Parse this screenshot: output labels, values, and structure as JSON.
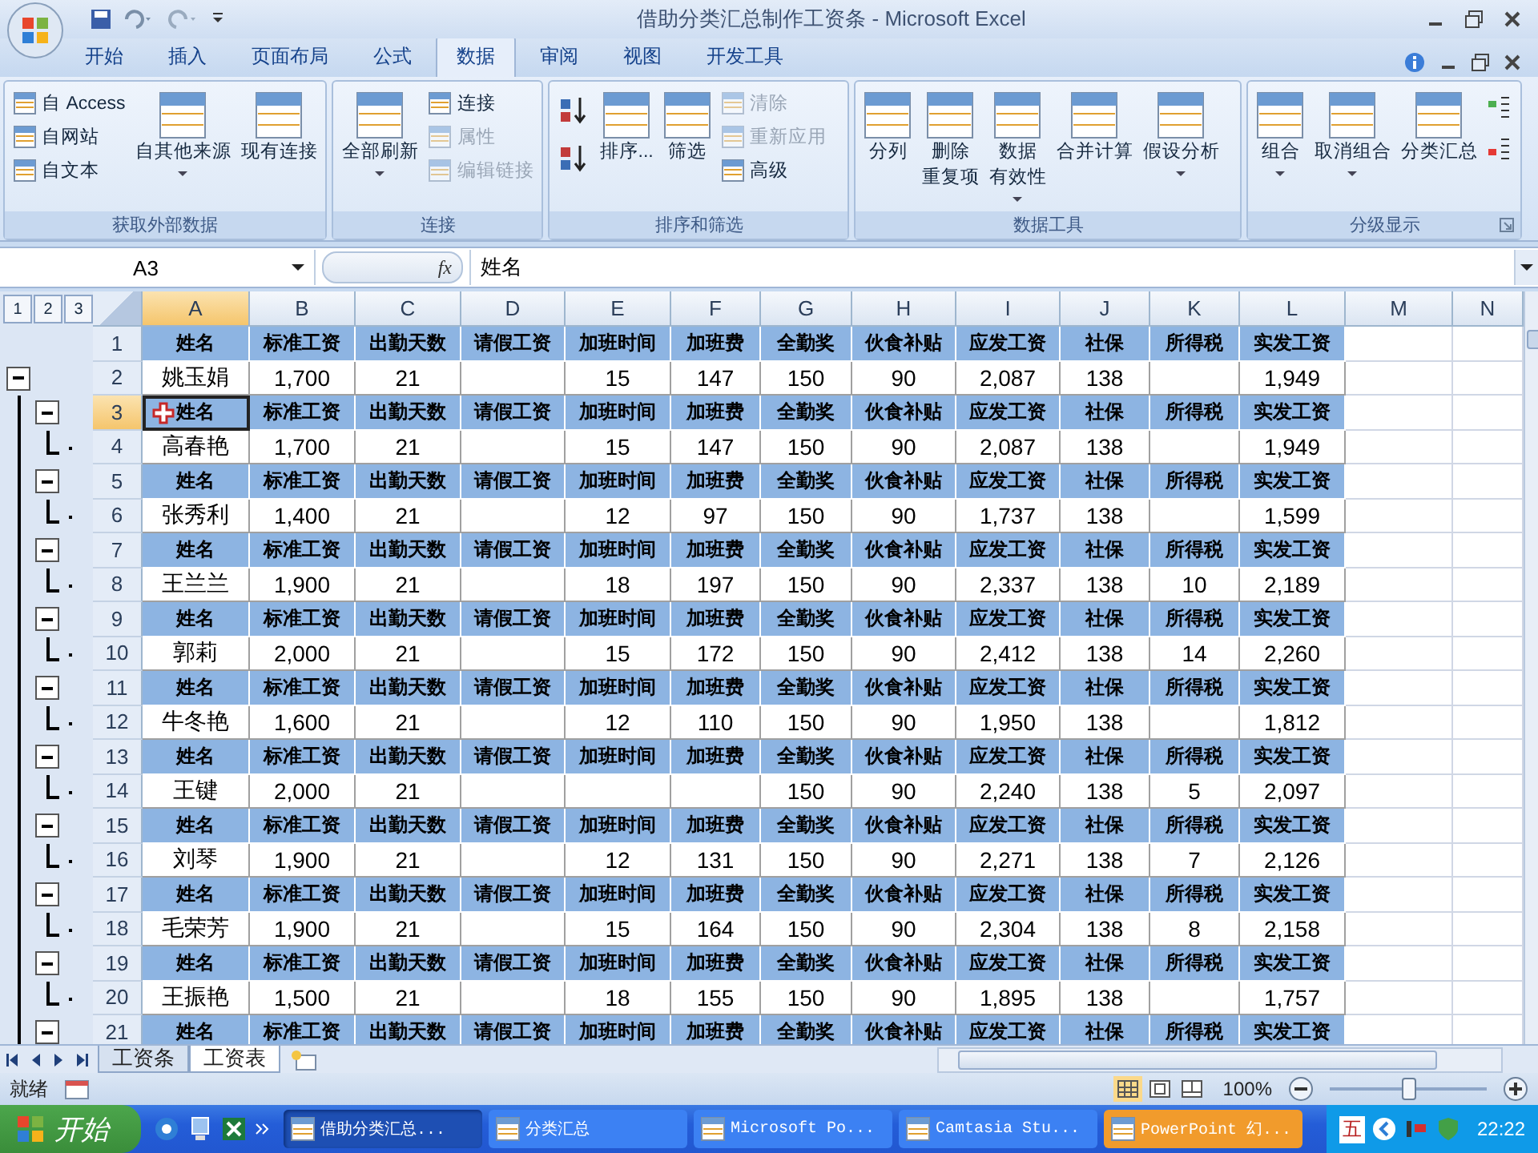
{
  "window": {
    "title": "借助分类汇总制作工资条 - Microsoft Excel"
  },
  "ribbon": {
    "tabs": [
      {
        "label": "开始",
        "selected": false
      },
      {
        "label": "插入",
        "selected": false
      },
      {
        "label": "页面布局",
        "selected": false
      },
      {
        "label": "公式",
        "selected": false
      },
      {
        "label": "数据",
        "selected": true
      },
      {
        "label": "审阅",
        "selected": false
      },
      {
        "label": "视图",
        "selected": false
      },
      {
        "label": "开发工具",
        "selected": false
      }
    ],
    "groups": [
      {
        "title": "获取外部数据",
        "launcher": false,
        "columns": [
          {
            "kind": "stack",
            "items": [
              {
                "label": "自 Access",
                "disabled": false
              },
              {
                "label": "自网站",
                "disabled": false
              },
              {
                "label": "自文本",
                "disabled": false
              }
            ]
          },
          {
            "kind": "large",
            "label_lines": [
              "自其他来源"
            ],
            "dropdown": true
          },
          {
            "kind": "large",
            "label_lines": [
              "现有连接"
            ],
            "dropdown": false
          }
        ]
      },
      {
        "title": "连接",
        "launcher": false,
        "columns": [
          {
            "kind": "large",
            "label_lines": [
              "全部刷新"
            ],
            "dropdown": true
          },
          {
            "kind": "stack",
            "items": [
              {
                "label": "连接",
                "disabled": false
              },
              {
                "label": "属性",
                "disabled": true
              },
              {
                "label": "编辑链接",
                "disabled": true
              }
            ]
          }
        ]
      },
      {
        "title": "排序和筛选",
        "launcher": false,
        "columns": [
          {
            "kind": "sort-buttons"
          },
          {
            "kind": "large",
            "label_lines": [
              "排序..."
            ],
            "dropdown": false
          },
          {
            "kind": "large",
            "label_lines": [
              "筛选"
            ],
            "dropdown": false
          },
          {
            "kind": "stack",
            "items": [
              {
                "label": "清除",
                "disabled": true
              },
              {
                "label": "重新应用",
                "disabled": true
              },
              {
                "label": "高级",
                "disabled": false
              }
            ]
          }
        ]
      },
      {
        "title": "数据工具",
        "launcher": false,
        "columns": [
          {
            "kind": "large",
            "label_lines": [
              "分列"
            ],
            "dropdown": false
          },
          {
            "kind": "large",
            "label_lines": [
              "删除",
              "重复项"
            ],
            "dropdown": false
          },
          {
            "kind": "large",
            "label_lines": [
              "数据",
              "有效性"
            ],
            "dropdown": true
          },
          {
            "kind": "large",
            "label_lines": [
              "合并计算"
            ],
            "dropdown": false
          },
          {
            "kind": "large",
            "label_lines": [
              "假设分析"
            ],
            "dropdown": true
          }
        ]
      },
      {
        "title": "分级显示",
        "launcher": true,
        "columns": [
          {
            "kind": "large",
            "label_lines": [
              "组合"
            ],
            "dropdown": true
          },
          {
            "kind": "large",
            "label_lines": [
              "取消组合"
            ],
            "dropdown": true
          },
          {
            "kind": "large",
            "label_lines": [
              "分类汇总"
            ],
            "dropdown": false
          },
          {
            "kind": "outline-buttons"
          }
        ]
      }
    ]
  },
  "formula_bar": {
    "name_box": "A3",
    "function_label": "fx",
    "formula": "姓名"
  },
  "sheet": {
    "outline_levels": [
      "1",
      "2",
      "3"
    ],
    "columns": [
      {
        "label": "A",
        "selected": true
      },
      {
        "label": "B",
        "selected": false
      },
      {
        "label": "C",
        "selected": false
      },
      {
        "label": "D",
        "selected": false
      },
      {
        "label": "E",
        "selected": false
      },
      {
        "label": "F",
        "selected": false
      },
      {
        "label": "G",
        "selected": false
      },
      {
        "label": "H",
        "selected": false
      },
      {
        "label": "I",
        "selected": false
      },
      {
        "label": "J",
        "selected": false
      },
      {
        "label": "K",
        "selected": false
      },
      {
        "label": "L",
        "selected": false
      },
      {
        "label": "M",
        "selected": false
      },
      {
        "label": "N",
        "selected": false
      }
    ],
    "rows": [
      {
        "number": "1",
        "kind": "header",
        "group_button": false,
        "subgroup_button": false,
        "detail_mark": false,
        "selected": false,
        "cells": [
          "姓名",
          "标准工资",
          "出勤天数",
          "请假工资",
          "加班时间",
          "加班费",
          "全勤奖",
          "伙食补贴",
          "应发工资",
          "社保",
          "所得税",
          "实发工资"
        ]
      },
      {
        "number": "2",
        "kind": "data",
        "group_button": true,
        "subgroup_button": false,
        "detail_mark": false,
        "selected": false,
        "cells": [
          "姚玉娟",
          "1,700",
          "21",
          null,
          "15",
          "147",
          "150",
          "90",
          "2,087",
          "138",
          null,
          "1,949"
        ]
      },
      {
        "number": "3",
        "kind": "header",
        "group_button": false,
        "subgroup_button": true,
        "detail_mark": false,
        "selected": true,
        "cells": [
          "姓名",
          "标准工资",
          "出勤天数",
          "请假工资",
          "加班时间",
          "加班费",
          "全勤奖",
          "伙食补贴",
          "应发工资",
          "社保",
          "所得税",
          "实发工资"
        ]
      },
      {
        "number": "4",
        "kind": "data",
        "group_button": false,
        "subgroup_button": false,
        "detail_mark": true,
        "selected": false,
        "cells": [
          "高春艳",
          "1,700",
          "21",
          null,
          "15",
          "147",
          "150",
          "90",
          "2,087",
          "138",
          null,
          "1,949"
        ]
      },
      {
        "number": "5",
        "kind": "header",
        "group_button": false,
        "subgroup_button": true,
        "detail_mark": false,
        "selected": false,
        "cells": [
          "姓名",
          "标准工资",
          "出勤天数",
          "请假工资",
          "加班时间",
          "加班费",
          "全勤奖",
          "伙食补贴",
          "应发工资",
          "社保",
          "所得税",
          "实发工资"
        ]
      },
      {
        "number": "6",
        "kind": "data",
        "group_button": false,
        "subgroup_button": false,
        "detail_mark": true,
        "selected": false,
        "cells": [
          "张秀利",
          "1,400",
          "21",
          null,
          "12",
          "97",
          "150",
          "90",
          "1,737",
          "138",
          null,
          "1,599"
        ]
      },
      {
        "number": "7",
        "kind": "header",
        "group_button": false,
        "subgroup_button": true,
        "detail_mark": false,
        "selected": false,
        "cells": [
          "姓名",
          "标准工资",
          "出勤天数",
          "请假工资",
          "加班时间",
          "加班费",
          "全勤奖",
          "伙食补贴",
          "应发工资",
          "社保",
          "所得税",
          "实发工资"
        ]
      },
      {
        "number": "8",
        "kind": "data",
        "group_button": false,
        "subgroup_button": false,
        "detail_mark": true,
        "selected": false,
        "cells": [
          "王兰兰",
          "1,900",
          "21",
          null,
          "18",
          "197",
          "150",
          "90",
          "2,337",
          "138",
          "10",
          "2,189"
        ]
      },
      {
        "number": "9",
        "kind": "header",
        "group_button": false,
        "subgroup_button": true,
        "detail_mark": false,
        "selected": false,
        "cells": [
          "姓名",
          "标准工资",
          "出勤天数",
          "请假工资",
          "加班时间",
          "加班费",
          "全勤奖",
          "伙食补贴",
          "应发工资",
          "社保",
          "所得税",
          "实发工资"
        ]
      },
      {
        "number": "10",
        "kind": "data",
        "group_button": false,
        "subgroup_button": false,
        "detail_mark": true,
        "selected": false,
        "cells": [
          "郭莉",
          "2,000",
          "21",
          null,
          "15",
          "172",
          "150",
          "90",
          "2,412",
          "138",
          "14",
          "2,260"
        ]
      },
      {
        "number": "11",
        "kind": "header",
        "group_button": false,
        "subgroup_button": true,
        "detail_mark": false,
        "selected": false,
        "cells": [
          "姓名",
          "标准工资",
          "出勤天数",
          "请假工资",
          "加班时间",
          "加班费",
          "全勤奖",
          "伙食补贴",
          "应发工资",
          "社保",
          "所得税",
          "实发工资"
        ]
      },
      {
        "number": "12",
        "kind": "data",
        "group_button": false,
        "subgroup_button": false,
        "detail_mark": true,
        "selected": false,
        "cells": [
          "牛冬艳",
          "1,600",
          "21",
          null,
          "12",
          "110",
          "150",
          "90",
          "1,950",
          "138",
          null,
          "1,812"
        ]
      },
      {
        "number": "13",
        "kind": "header",
        "group_button": false,
        "subgroup_button": true,
        "detail_mark": false,
        "selected": false,
        "cells": [
          "姓名",
          "标准工资",
          "出勤天数",
          "请假工资",
          "加班时间",
          "加班费",
          "全勤奖",
          "伙食补贴",
          "应发工资",
          "社保",
          "所得税",
          "实发工资"
        ]
      },
      {
        "number": "14",
        "kind": "data",
        "group_button": false,
        "subgroup_button": false,
        "detail_mark": true,
        "selected": false,
        "cells": [
          "王键",
          "2,000",
          "21",
          null,
          null,
          null,
          "150",
          "90",
          "2,240",
          "138",
          "5",
          "2,097"
        ]
      },
      {
        "number": "15",
        "kind": "header",
        "group_button": false,
        "subgroup_button": true,
        "detail_mark": false,
        "selected": false,
        "cells": [
          "姓名",
          "标准工资",
          "出勤天数",
          "请假工资",
          "加班时间",
          "加班费",
          "全勤奖",
          "伙食补贴",
          "应发工资",
          "社保",
          "所得税",
          "实发工资"
        ]
      },
      {
        "number": "16",
        "kind": "data",
        "group_button": false,
        "subgroup_button": false,
        "detail_mark": true,
        "selected": false,
        "cells": [
          "刘琴",
          "1,900",
          "21",
          null,
          "12",
          "131",
          "150",
          "90",
          "2,271",
          "138",
          "7",
          "2,126"
        ]
      },
      {
        "number": "17",
        "kind": "header",
        "group_button": false,
        "subgroup_button": true,
        "detail_mark": false,
        "selected": false,
        "cells": [
          "姓名",
          "标准工资",
          "出勤天数",
          "请假工资",
          "加班时间",
          "加班费",
          "全勤奖",
          "伙食补贴",
          "应发工资",
          "社保",
          "所得税",
          "实发工资"
        ]
      },
      {
        "number": "18",
        "kind": "data",
        "group_button": false,
        "subgroup_button": false,
        "detail_mark": true,
        "selected": false,
        "cells": [
          "毛荣芳",
          "1,900",
          "21",
          null,
          "15",
          "164",
          "150",
          "90",
          "2,304",
          "138",
          "8",
          "2,158"
        ]
      },
      {
        "number": "19",
        "kind": "header",
        "group_button": false,
        "subgroup_button": true,
        "detail_mark": false,
        "selected": false,
        "cells": [
          "姓名",
          "标准工资",
          "出勤天数",
          "请假工资",
          "加班时间",
          "加班费",
          "全勤奖",
          "伙食补贴",
          "应发工资",
          "社保",
          "所得税",
          "实发工资"
        ]
      },
      {
        "number": "20",
        "kind": "data",
        "group_button": false,
        "subgroup_button": false,
        "detail_mark": true,
        "selected": false,
        "cells": [
          "王振艳",
          "1,500",
          "21",
          null,
          "18",
          "155",
          "150",
          "90",
          "1,895",
          "138",
          null,
          "1,757"
        ]
      },
      {
        "number": "21",
        "kind": "header",
        "group_button": false,
        "subgroup_button": true,
        "detail_mark": false,
        "selected": false,
        "cells": [
          "姓名",
          "标准工资",
          "出勤天数",
          "请假工资",
          "加班时间",
          "加班费",
          "全勤奖",
          "伙食补贴",
          "应发工资",
          "社保",
          "所得税",
          "实发工资"
        ]
      }
    ]
  },
  "sheet_tabs": [
    {
      "label": "工资条",
      "selected": false
    },
    {
      "label": "工资表",
      "selected": true
    }
  ],
  "status_bar": {
    "status": "就绪",
    "zoom": "100%",
    "zoom_slider": {
      "level": 0.5
    }
  },
  "taskbar": {
    "start": "开始",
    "tasks": [
      {
        "label": "借助分类汇总...",
        "selected": true,
        "flashing": false
      },
      {
        "label": "分类汇总",
        "selected": false,
        "flashing": false
      },
      {
        "label": "Microsoft Po...",
        "selected": false,
        "flashing": false
      },
      {
        "label": "Camtasia Stu...",
        "selected": false,
        "flashing": false
      },
      {
        "label": "PowerPoint 幻...",
        "selected": false,
        "flashing": true
      }
    ],
    "ime": "五",
    "clock": "22:22"
  }
}
